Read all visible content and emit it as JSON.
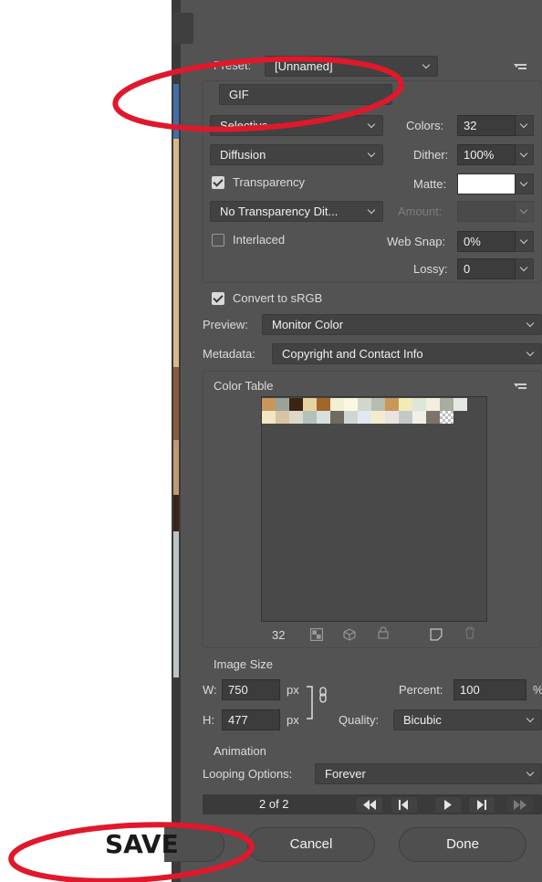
{
  "preset": {
    "label": "Preset:",
    "value": "[Unnamed]"
  },
  "format": {
    "value": "GIF"
  },
  "reduction": {
    "value": "Selective"
  },
  "colors": {
    "label": "Colors:",
    "value": "32"
  },
  "dither_algorithm": {
    "value": "Diffusion"
  },
  "dither": {
    "label": "Dither:",
    "value": "100%"
  },
  "transparency": {
    "label": "Transparency",
    "checked": true
  },
  "matte": {
    "label": "Matte:",
    "color": "#ffffff"
  },
  "transparency_dither": {
    "value": "No Transparency Dit..."
  },
  "amount": {
    "label": "Amount:",
    "value": ""
  },
  "interlaced": {
    "label": "Interlaced",
    "checked": false
  },
  "web_snap": {
    "label": "Web Snap:",
    "value": "0%"
  },
  "lossy": {
    "label": "Lossy:",
    "value": "0"
  },
  "convert_srgb": {
    "label": "Convert to sRGB",
    "checked": true
  },
  "preview": {
    "label": "Preview:",
    "value": "Monitor Color"
  },
  "metadata": {
    "label": "Metadata:",
    "value": "Copyright and Contact Info"
  },
  "color_table": {
    "title": "Color Table",
    "count": "32",
    "swatches": [
      "#c8965a",
      "#9aa39a",
      "#3b2414",
      "#e8d3a0",
      "#a0662a",
      "#f4efd2",
      "#fbf8e2",
      "#d2d6cc",
      "#b6bcb0",
      "#c89858",
      "#f2eab8",
      "#dde6d8",
      "#f4eee0",
      "#a8ad9d",
      "#e2e9e4",
      "#f0e6c4",
      "#d9c3a2",
      "#dcd9c8",
      "#b4c0ba",
      "#d8e0de",
      "#6f6a62",
      "#cfd7d3",
      "#e2e9ee",
      "#f3ecd0",
      "#ece2e4",
      "#c4c9c8",
      "#f0f0e6",
      "#7a746c",
      "checker"
    ]
  },
  "image_size": {
    "title": "Image Size",
    "w_label": "W:",
    "w_value": "750",
    "w_unit": "px",
    "h_label": "H:",
    "h_value": "477",
    "h_unit": "px",
    "percent_label": "Percent:",
    "percent_value": "100",
    "percent_unit": "%",
    "quality_label": "Quality:",
    "quality_value": "Bicubic"
  },
  "animation": {
    "title": "Animation",
    "looping_label": "Looping Options:",
    "looping_value": "Forever",
    "frame": "2 of 2"
  },
  "buttons": {
    "cancel": "Cancel",
    "done": "Done"
  },
  "annotation": {
    "save_text": "SAVE",
    "oval_color": "#e0182b"
  }
}
